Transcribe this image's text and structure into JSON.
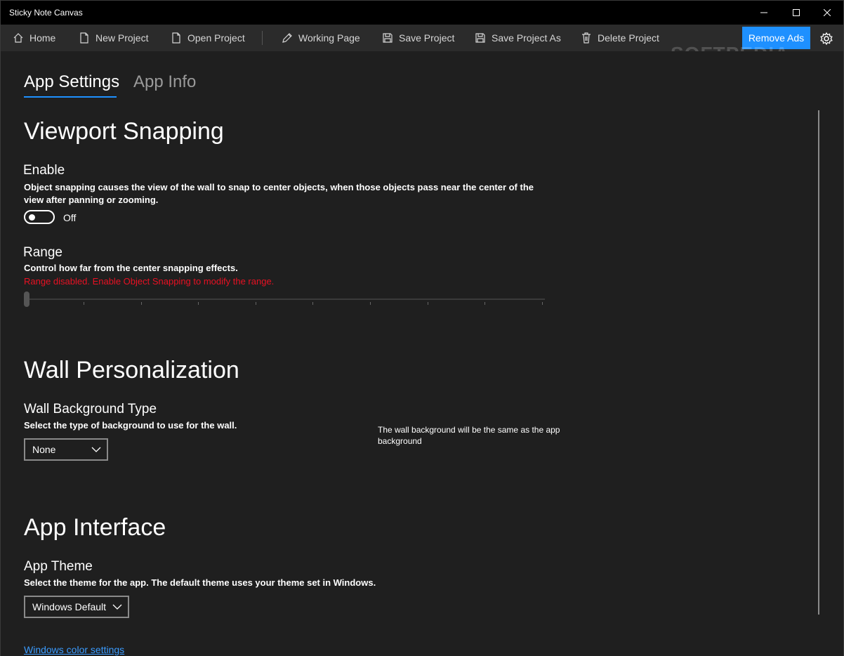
{
  "window": {
    "title": "Sticky Note Canvas"
  },
  "toolbar": {
    "home": "Home",
    "new_project": "New Project",
    "open_project": "Open Project",
    "working_page": "Working Page",
    "save_project": "Save Project",
    "save_project_as": "Save Project As",
    "delete_project": "Delete Project",
    "remove_ads": "Remove Ads"
  },
  "watermark": "SOFTPEDIA",
  "tabs": [
    {
      "label": "App Settings",
      "active": true
    },
    {
      "label": "App Info",
      "active": false
    }
  ],
  "viewport_snapping": {
    "heading": "Viewport Snapping",
    "enable": {
      "title": "Enable",
      "description_line1": "Object snapping causes the view of the wall to snap to center objects, when those objects pass near the center of the",
      "description_line2": "view after panning or zooming.",
      "state_label": "Off",
      "on": false
    },
    "range": {
      "title": "Range",
      "description": "Control how far from the center snapping effects.",
      "error": "Range disabled. Enable Object Snapping to modify the range.",
      "value": 0
    }
  },
  "wall_personalization": {
    "heading": "Wall Personalization",
    "background_type": {
      "title": "Wall Background Type",
      "description": "Select the type of background to use for the wall.",
      "selected": "None",
      "note_line1": "The wall background will be the same as the app",
      "note_line2": "background"
    }
  },
  "app_interface": {
    "heading": "App Interface",
    "theme": {
      "title": "App Theme",
      "description": "Select the theme for the app. The default theme uses your theme set in Windows.",
      "selected": "Windows Default"
    },
    "link": "Windows color settings"
  },
  "colors": {
    "accent": "#1e90ff",
    "error": "#e81123",
    "background": "#1f1f1f",
    "toolbar": "#2b2b2b",
    "titlebar": "#000000"
  }
}
